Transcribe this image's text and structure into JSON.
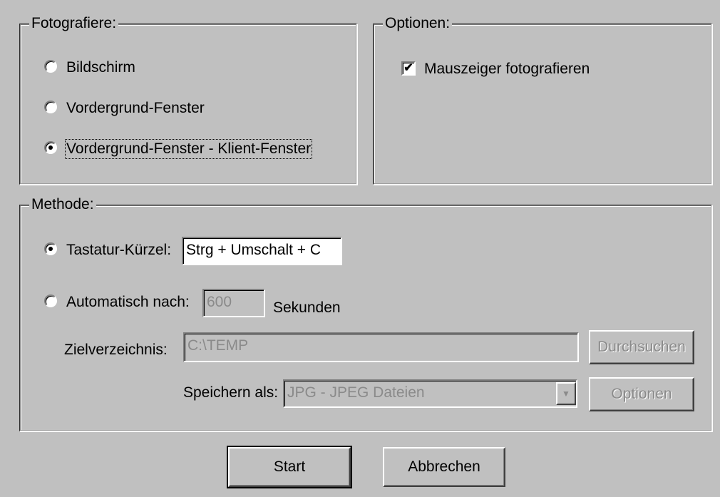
{
  "capture": {
    "legend": "Fotografiere:",
    "options": [
      {
        "label": "Bildschirm",
        "selected": false
      },
      {
        "label": "Vordergrund-Fenster",
        "selected": false
      },
      {
        "label": "Vordergrund-Fenster - Klient-Fenster",
        "selected": true
      }
    ]
  },
  "options_group": {
    "legend": "Optionen:",
    "mouse_label": "Mauszeiger fotografieren",
    "mouse_checked": true
  },
  "method": {
    "legend": "Methode:",
    "hotkey_label": "Tastatur-Kürzel:",
    "hotkey_value": "Strg + Umschalt + C",
    "hotkey_selected": true,
    "auto_label": "Automatisch nach:",
    "auto_value": "600",
    "auto_unit": "Sekunden",
    "target_label": "Zielverzeichnis:",
    "target_value": "C:\\TEMP",
    "browse_button": "Durchsuchen",
    "save_as_label": "Speichern als:",
    "save_as_value": "JPG - JPEG Dateien",
    "options_button": "Optionen"
  },
  "footer": {
    "start_button": "Start",
    "cancel_button": "Abbrechen"
  }
}
